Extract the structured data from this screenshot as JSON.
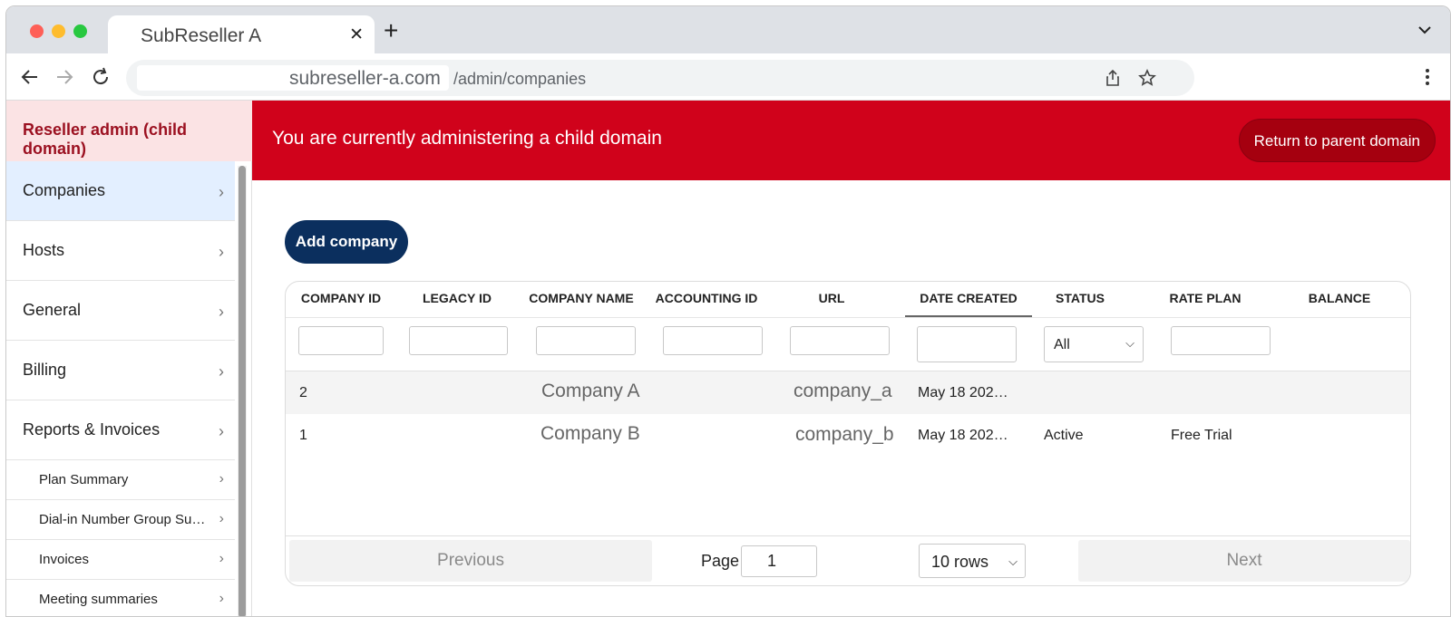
{
  "browser": {
    "tab_title": "SubReseller A",
    "tab_close": "✕",
    "new_tab": "+",
    "url_host": "subreseller-a.com",
    "url_path": "/admin/companies"
  },
  "sidebar": {
    "header": "Reseller admin (child domain)",
    "chevron": "›",
    "items": [
      {
        "label": "Companies"
      },
      {
        "label": "Hosts"
      },
      {
        "label": "General"
      },
      {
        "label": "Billing"
      },
      {
        "label": "Reports & Invoices"
      }
    ],
    "sub_items": [
      {
        "label": "Plan Summary"
      },
      {
        "label": "Dial-in Number Group Summary"
      },
      {
        "label": "Invoices"
      },
      {
        "label": "Meeting summaries"
      }
    ]
  },
  "banner": {
    "message": "You are currently administering a child domain",
    "return_label": "Return to parent domain"
  },
  "main": {
    "add_company_label": "Add company"
  },
  "table": {
    "columns": [
      "COMPANY ID",
      "LEGACY ID",
      "COMPANY NAME",
      "ACCOUNTING ID",
      "URL",
      "DATE CREATED",
      "STATUS",
      "RATE PLAN",
      "BALANCE"
    ],
    "status_filter_value": "All",
    "select_arrow": "⌵",
    "rows": [
      {
        "company_id": "2",
        "company_name": "Company A",
        "url": "company_a",
        "date_created": "May 18 202…",
        "status": "",
        "rate_plan": ""
      },
      {
        "company_id": "1",
        "company_name": "Company B",
        "url": "company_b",
        "date_created": "May 18 202…",
        "status": "Active",
        "rate_plan": "Free Trial"
      }
    ],
    "pagination": {
      "previous_label": "Previous",
      "page_label": "Page",
      "page_value": "1",
      "rows_value": "10 rows",
      "next_label": "Next"
    }
  }
}
